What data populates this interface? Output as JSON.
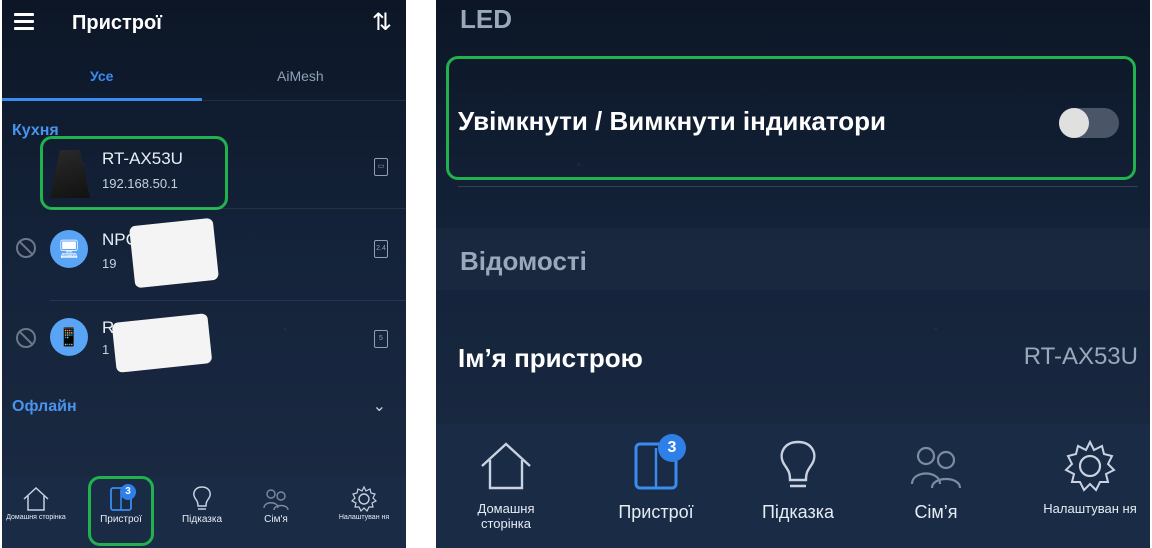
{
  "left": {
    "title": "Пристрої",
    "tabs": [
      "Усе",
      "AiMesh"
    ],
    "groups": {
      "kitchen": "Кухня",
      "offline": "Офлайн"
    },
    "devices": [
      {
        "name": "RT-AX53U",
        "ip": "192.168.50.1",
        "band_icon": "ethernet-icon"
      },
      {
        "name": "NPC",
        "ip": "19",
        "band_icon": "2.4"
      },
      {
        "name": "Redm",
        "ip": "1",
        "band_icon": "5"
      }
    ],
    "nav": [
      {
        "label": "Домашня сторінка",
        "icon": "home-icon"
      },
      {
        "label": "Пристрої",
        "icon": "devices-icon",
        "badge": "3"
      },
      {
        "label": "Підказка",
        "icon": "bulb-icon"
      },
      {
        "label": "Сім'я",
        "icon": "family-icon"
      },
      {
        "label": "Налаштуван ня",
        "icon": "gear-icon"
      }
    ]
  },
  "right": {
    "sections": {
      "led": "LED",
      "info": "Відомості"
    },
    "led_toggle_label": "Увімкнути / Вимкнути індикатори",
    "led_toggle_state": "off",
    "device_name_label": "Ім’я пристрою",
    "device_name_value": "RT-AX53U",
    "nav": [
      {
        "label": "Домашня сторінка",
        "icon": "home-icon"
      },
      {
        "label": "Пристрої",
        "icon": "devices-icon",
        "badge": "3"
      },
      {
        "label": "Підказка",
        "icon": "bulb-icon"
      },
      {
        "label": "Сім’я",
        "icon": "family-icon"
      },
      {
        "label": "Налаштуван ня",
        "icon": "gear-icon"
      }
    ]
  },
  "colors": {
    "accent": "#3a8cf0",
    "highlight": "#22b14c",
    "nav_bg": "#1a2b45",
    "badge": "#2f7fe8"
  }
}
